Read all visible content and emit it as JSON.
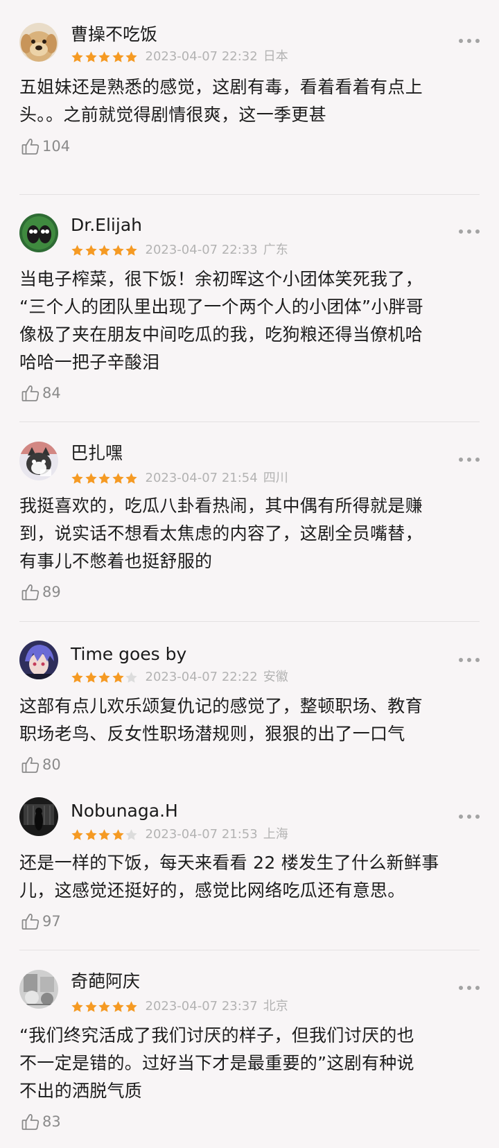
{
  "colors": {
    "background": "#f8f5f6",
    "star_filled": "#f59a23",
    "star_empty": "#dcdcdc",
    "meta_text": "#b3b3b3",
    "like_text": "#8a8a8a"
  },
  "reviews": [
    {
      "username": "曹操不吃饭",
      "rating": 5,
      "date": "2023-04-07 22:32",
      "location": "日本",
      "lines": [
        "五姐妹还是熟悉的感觉，这剧有毒，看着看着有点上",
        "头。。之前就觉得剧情很爽，这一季更甚"
      ],
      "likes": "104",
      "avatar": "dog-photo"
    },
    {
      "username": "Dr.Elijah",
      "rating": 5,
      "date": "2023-04-07 22:33",
      "location": "广东",
      "lines": [
        "当电子榨菜，很下饭！余初晖这个小团体笑死我了，",
        "“三个人的团队里出现了一个两个人的小团体”小胖哥",
        "像极了夹在朋友中间吃瓜的我，吃狗粮还得当僚机哈",
        "哈哈一把子辛酸泪"
      ],
      "likes": "84",
      "avatar": "cartoon-characters"
    },
    {
      "username": "巴扎嘿",
      "rating": 5,
      "date": "2023-04-07 21:54",
      "location": "四川",
      "lines": [
        "我挺喜欢的，吃瓜八卦看热闹，其中偶有所得就是赚",
        "到，说实话不想看太焦虑的内容了，这剧全员嘴替，",
        "有事儿不憋着也挺舒服的"
      ],
      "likes": "89",
      "avatar": "cartoon-cat"
    },
    {
      "username": "Time goes by",
      "rating": 4,
      "date": "2023-04-07 22:22",
      "location": "安徽",
      "lines": [
        "这部有点儿欢乐颂复仇记的感觉了，整顿职场、教育",
        "职场老鸟、反女性职场潜规则，狠狠的出了一口气"
      ],
      "likes": "80",
      "avatar": "anime-character"
    },
    {
      "username": "Nobunaga.H",
      "rating": 4,
      "date": "2023-04-07 21:53",
      "location": "上海",
      "lines": [
        "还是一样的下饭，每天来看看 22 楼发生了什么新鲜事",
        "儿，这感觉还挺好的，感觉比网络吃瓜还有意思。"
      ],
      "likes": "97",
      "avatar": "dark-photo"
    },
    {
      "username": "奇葩阿庆",
      "rating": 5,
      "date": "2023-04-07 23:37",
      "location": "北京",
      "lines": [
        "“我们终究活成了我们讨厌的样子，但我们讨厌的也",
        "不一定是错的。过好当下才是最重要的”这剧有种说",
        "不出的洒脱气质"
      ],
      "likes": "83",
      "avatar": "sketch-photo"
    }
  ]
}
